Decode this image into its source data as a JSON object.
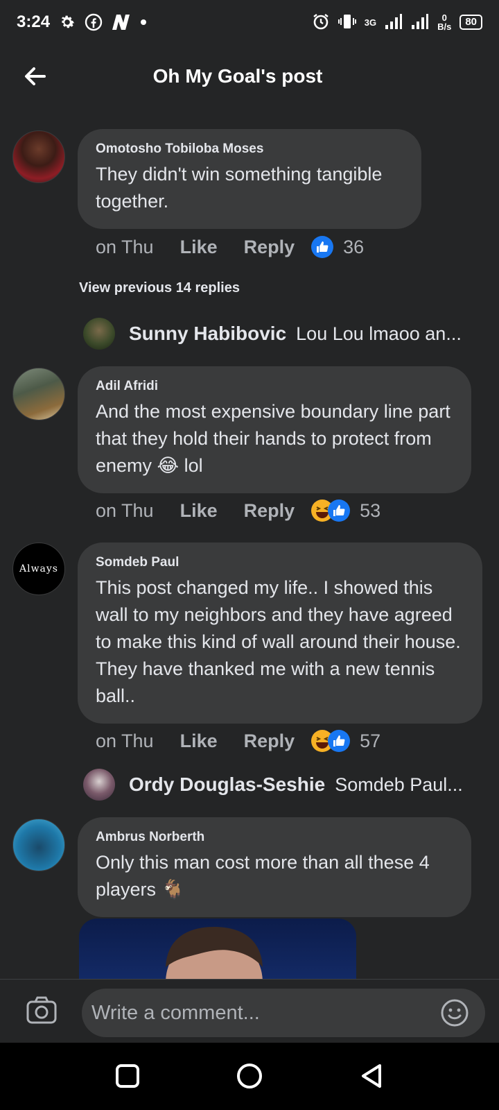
{
  "status_bar": {
    "time": "3:24",
    "network_type": "3G",
    "speed_value": "0",
    "speed_unit": "B/s",
    "battery": "80"
  },
  "header": {
    "title": "Oh My Goal's post"
  },
  "comments": [
    {
      "author": "Omotosho Tobiloba Moses",
      "text": "They didn't win something tangible together.",
      "time": "on Thu",
      "like_label": "Like",
      "reply_label": "Reply",
      "reactions": [
        "like-icon"
      ],
      "reaction_count": "36"
    },
    {
      "author": "Adil Afridi",
      "text": "And the most expensive boundary line part that they hold their hands to protect from enemy 😂 lol",
      "time": "on Thu",
      "like_label": "Like",
      "reply_label": "Reply",
      "reactions": [
        "haha-icon",
        "like-icon"
      ],
      "reaction_count": "53"
    },
    {
      "author": "Somdeb Paul",
      "text": "This post changed my life.. I showed this wall to my neighbors and they have agreed to make this kind of wall around their house. They have thanked me with a new tennis ball..",
      "time": "on Thu",
      "like_label": "Like",
      "reply_label": "Reply",
      "reactions": [
        "haha-icon",
        "like-icon"
      ],
      "reaction_count": "57"
    },
    {
      "author": "Ambrus Norberth",
      "text": "Only this man cost more than all these 4 players 🐐"
    }
  ],
  "view_previous_replies": "View previous 14 replies",
  "reply_previews": [
    {
      "name": "Sunny Habibovic",
      "text": "Lou Lou lmaoo an..."
    },
    {
      "name": "Ordy Douglas-Seshie",
      "text": "Somdeb Paul..."
    }
  ],
  "somdeb_avatar_text": "Always",
  "composer": {
    "placeholder": "Write a comment..."
  },
  "colors": {
    "background": "#242526",
    "bubble": "#3a3b3c",
    "like_blue": "#1877f2",
    "haha_yellow": "#f7b125",
    "muted_text": "#b0b3b8"
  }
}
